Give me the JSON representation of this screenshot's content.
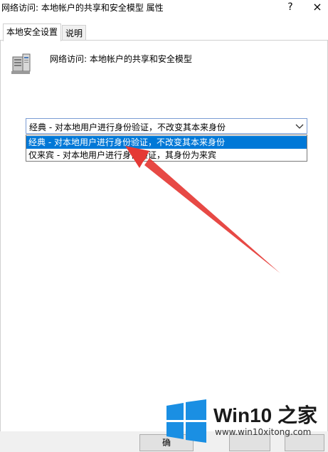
{
  "window": {
    "title": "网络访问: 本地帐户的共享和安全模型 属性",
    "help_glyph": "?",
    "close_glyph": "×"
  },
  "tabs": [
    {
      "label": "本地安全设置",
      "active": true
    },
    {
      "label": "说明",
      "active": false
    }
  ],
  "policy": {
    "icon": "server-computer-icon",
    "name": "网络访问: 本地帐户的共享和安全模型"
  },
  "dropdown": {
    "selected": "经典 - 对本地用户进行身份验证，不改变其本来身份",
    "options": [
      {
        "label": "经典 - 对本地用户进行身份验证，不改变其本来身份",
        "highlighted": true
      },
      {
        "label": "仅来宾 - 对本地用户进行身份验证，其身份为来宾",
        "highlighted": false
      }
    ]
  },
  "annotation": {
    "icon": "red-arrow-pointer",
    "color": "#e53935"
  },
  "watermark": {
    "logo": "windows-logo-icon",
    "title": "Win10 之家",
    "url": "www.win10xitong.com",
    "accent": "#1a8fe3"
  },
  "buttons": {
    "ok_partial": "确"
  }
}
